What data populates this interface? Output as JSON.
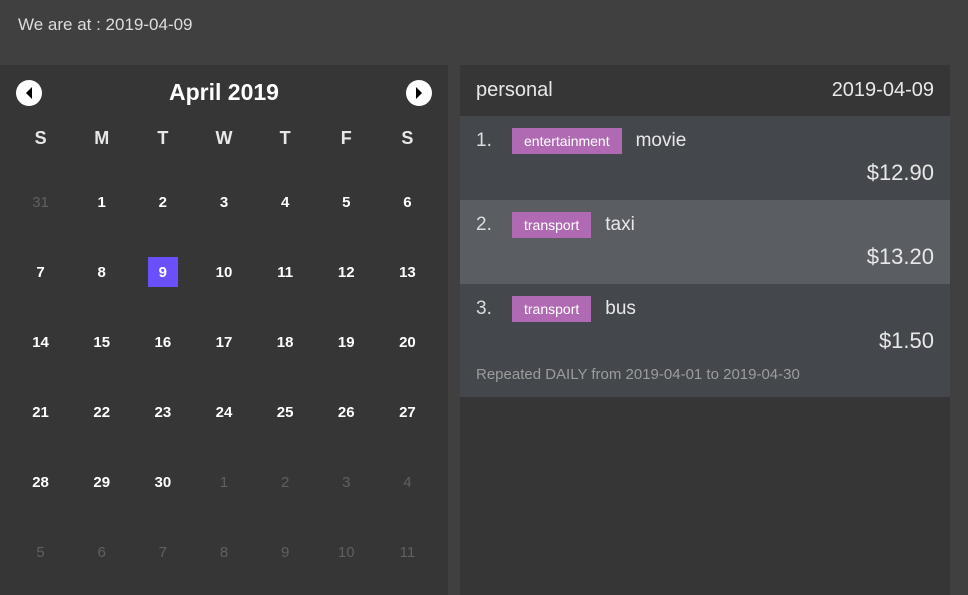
{
  "header": {
    "label": "We are at : 2019-04-09"
  },
  "calendar": {
    "title": "April  2019",
    "dow": [
      "S",
      "M",
      "T",
      "W",
      "T",
      "F",
      "S"
    ],
    "cells": [
      {
        "d": "31",
        "muted": true
      },
      {
        "d": "1"
      },
      {
        "d": "2"
      },
      {
        "d": "3"
      },
      {
        "d": "4"
      },
      {
        "d": "5"
      },
      {
        "d": "6"
      },
      {
        "d": "7"
      },
      {
        "d": "8"
      },
      {
        "d": "9",
        "selected": true
      },
      {
        "d": "10"
      },
      {
        "d": "11"
      },
      {
        "d": "12"
      },
      {
        "d": "13"
      },
      {
        "d": "14"
      },
      {
        "d": "15"
      },
      {
        "d": "16"
      },
      {
        "d": "17"
      },
      {
        "d": "18"
      },
      {
        "d": "19"
      },
      {
        "d": "20"
      },
      {
        "d": "21"
      },
      {
        "d": "22"
      },
      {
        "d": "23"
      },
      {
        "d": "24"
      },
      {
        "d": "25"
      },
      {
        "d": "26"
      },
      {
        "d": "27"
      },
      {
        "d": "28"
      },
      {
        "d": "29"
      },
      {
        "d": "30"
      },
      {
        "d": "1",
        "muted": true
      },
      {
        "d": "2",
        "muted": true
      },
      {
        "d": "3",
        "muted": true
      },
      {
        "d": "4",
        "muted": true
      },
      {
        "d": "5",
        "muted": true
      },
      {
        "d": "6",
        "muted": true
      },
      {
        "d": "7",
        "muted": true
      },
      {
        "d": "8",
        "muted": true
      },
      {
        "d": "9",
        "muted": true
      },
      {
        "d": "10",
        "muted": true
      },
      {
        "d": "11",
        "muted": true
      }
    ]
  },
  "entries": {
    "account": "personal",
    "date": "2019-04-09",
    "items": [
      {
        "num": "1.",
        "tag": "entertainment",
        "name": "movie",
        "amount": "$12.90",
        "alt": false
      },
      {
        "num": "2.",
        "tag": "transport",
        "name": "taxi",
        "amount": "$13.20",
        "alt": true
      },
      {
        "num": "3.",
        "tag": "transport",
        "name": "bus",
        "amount": "$1.50",
        "alt": false,
        "repeat": "Repeated DAILY from 2019-04-01 to 2019-04-30"
      }
    ]
  }
}
